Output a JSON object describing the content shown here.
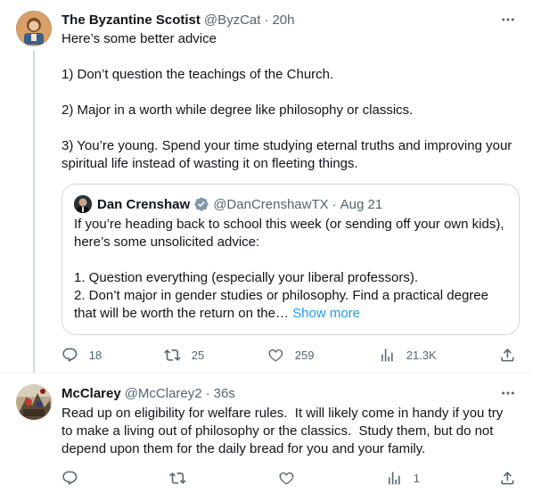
{
  "tweet1": {
    "name": "The Byzantine Scotist",
    "handle": "@ByzCat",
    "dot": "·",
    "time": "20h",
    "lines": [
      "Here’s some better advice",
      "1) Don’t question the teachings of the Church.",
      "2) Major in a worth while degree like philosophy or classics.",
      "3) You’re young. Spend your time studying eternal truths and improving your spiritual life instead of wasting it on fleeting things."
    ],
    "quote": {
      "name": "Dan Crenshaw",
      "handle": "@DanCrenshawTX",
      "dot": "·",
      "time": "Aug 21",
      "intro": "If you’re heading back to school this week (or sending off your own kids), here’s some unsolicited advice:",
      "point1": "1. Question everything (especially your liberal professors).",
      "point2": "2. Don’t major in gender studies or philosophy. Find a practical degree that will be worth the return on the…",
      "show_more": "Show more"
    },
    "actions": {
      "replies": "18",
      "retweets": "25",
      "likes": "259",
      "views": "21.3K"
    }
  },
  "tweet2": {
    "name": "McClarey",
    "handle": "@McClarey2",
    "dot": "·",
    "time": "36s",
    "text": "Read up on eligibility for welfare rules.  It will likely come in handy if you try to make a living out of philosophy or the classics.  Study them, but do not depend upon them for the daily bread for you and your family.",
    "actions": {
      "views": "1"
    }
  },
  "colors": {
    "text_primary": "#0f1419",
    "text_secondary": "#536471",
    "link": "#1d9bf0",
    "border": "#cfd9de"
  },
  "icons": [
    "more-icon",
    "verified-badge-icon",
    "reply-icon",
    "retweet-icon",
    "like-icon",
    "views-icon",
    "share-icon"
  ]
}
